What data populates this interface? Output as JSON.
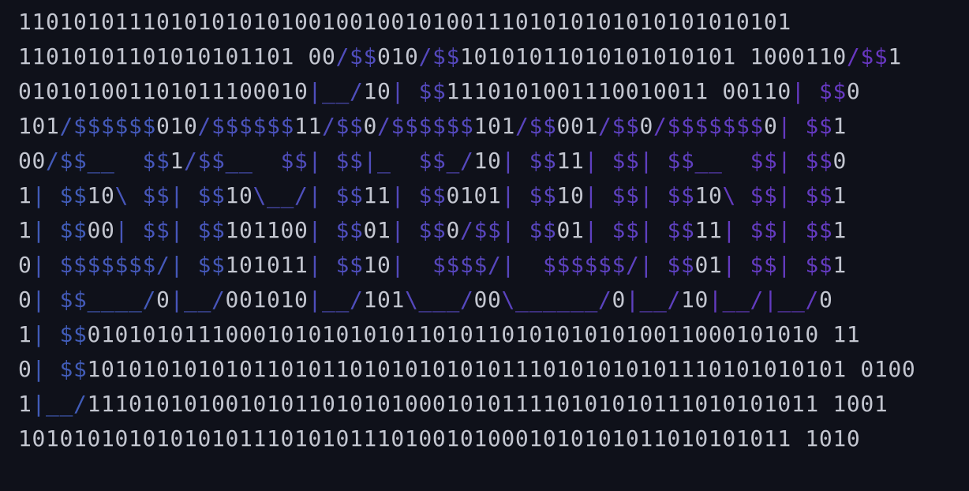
{
  "colors": {
    "background": "#0f111a",
    "digits": "#c3c6d0",
    "art_left": "#3f5eb8",
    "art_mid": "#5647bd",
    "art_right": "#6a35c2"
  },
  "banner_lines": [
    "11010101110101010101001001001010011101010101010101010101",
    "11010101101010101101 00/$$010/$$10101011010101010101 1000110/$$1",
    "010101001101011100010|__/10| $$1110101001110010011 00110| $$0",
    "101/$$$$$$010/$$$$$$11/$$0/$$$$$$101/$$001/$$0/$$$$$$$0| $$1",
    "00/$$__  $$1/$$__  $$| $$|_  $$_/10| $$11| $$| $$__  $$| $$0",
    "1| $$10\\ $$| $$10\\__/| $$11| $$0101| $$10| $$| $$10\\ $$| $$1",
    "1| $$00| $$| $$101100| $$01| $$0/$$| $$01| $$| $$11| $$| $$1",
    "0| $$$$$$$/| $$101011| $$10|  $$$$/|  $$$$$$/| $$01| $$| $$1",
    "0| $$____/0|__/001010|__/101\\___/00\\______/0|__/10|__/|__/0",
    "1| $$01010101110001010101010110101101010101010011000101010 11",
    "0| $$1010101010101101011010101010101110101010101110101010101 0100",
    "1|__/11101010100101011010101000101011110101010111010101011 1001",
    "10101010101010101110101011101001010001010101011010101011 1010"
  ]
}
